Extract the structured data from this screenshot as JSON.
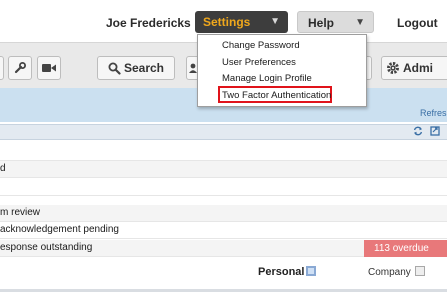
{
  "header": {
    "user_name": "Joe Fredericks",
    "settings_label": "Settings",
    "help_label": "Help",
    "logout_label": "Logout"
  },
  "settings_menu": {
    "items": [
      "Change Password",
      "User Preferences",
      "Manage Login Profile",
      "Two Factor Authentication"
    ]
  },
  "toolbar": {
    "search_label": "Search",
    "admin_label": "Admi"
  },
  "panel": {
    "refresh_label": "Refres"
  },
  "rows": [
    {
      "text": ""
    },
    {
      "text": "d"
    },
    {
      "text": ""
    },
    {
      "text": "m review"
    },
    {
      "text": "acknowledgement pending"
    },
    {
      "text": "esponse outstanding",
      "badge": "113 overdue"
    }
  ],
  "footer": {
    "personal_label": "Personal",
    "company_label": "Company"
  },
  "colors": {
    "accent": "#f0a81c",
    "settings_bg": "#3d3d3d",
    "overdue_bg": "#e8787a",
    "highlight": "#e0131a"
  }
}
